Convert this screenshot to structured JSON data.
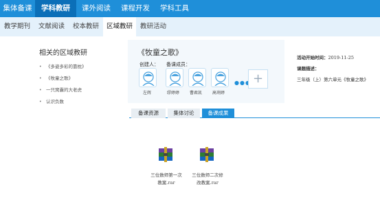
{
  "top_nav": [
    {
      "label": "集体备课"
    },
    {
      "label": "学科教研"
    },
    {
      "label": "课外阅读"
    },
    {
      "label": "课程开发"
    },
    {
      "label": "学科工具"
    }
  ],
  "sub_nav": [
    {
      "label": "教学期刊"
    },
    {
      "label": "文献阅读"
    },
    {
      "label": "校本教研"
    },
    {
      "label": "区域教研"
    },
    {
      "label": "教研活动"
    }
  ],
  "related": {
    "title": "相关的区域教研",
    "items": [
      "《多姿多彩的靠枕》",
      "《牧童之歌》",
      "一只窝囊的大老虎",
      "认识负数"
    ]
  },
  "activity": {
    "title": "《牧童之歌》",
    "creator_label": "创建人：",
    "members_label": "备课成员：",
    "creator": "左辉",
    "members": [
      "缪婷婷",
      "曹君凯",
      "高琍婷"
    ],
    "more": "●●●",
    "add": "+",
    "start_label": "活动开始时间：",
    "start_time": "2019-11-25",
    "desc_label": "课题描述：",
    "desc": "三年级（上）第六单元《牧童之歌》"
  },
  "tabs": [
    {
      "label": "备课资源"
    },
    {
      "label": "集体讨论"
    },
    {
      "label": "备课成果"
    }
  ],
  "files": [
    {
      "line1": "三位数师第一次",
      "line2": "教案.rar"
    },
    {
      "line1": "三位数师二次修",
      "line2": "改教案.rar"
    }
  ],
  "colors": {
    "accent": "#1f8fd9",
    "accent_dark": "#0b6fb8",
    "subnav_bg": "#e4f1fb"
  }
}
